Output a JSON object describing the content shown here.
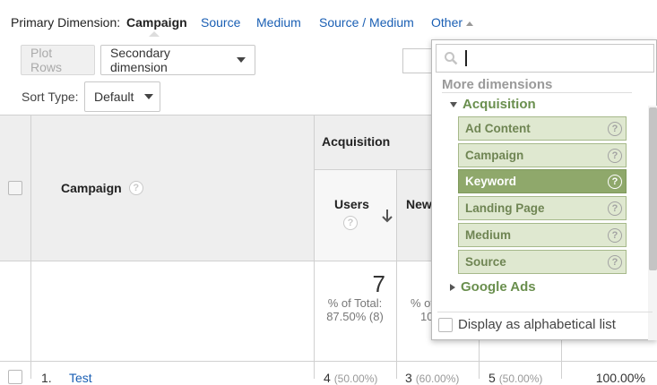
{
  "primary_dimension": {
    "label": "Primary Dimension:",
    "active": "Campaign",
    "options": [
      "Source",
      "Medium",
      "Source / Medium",
      "Other"
    ]
  },
  "toolbar": {
    "plot_rows": "Plot Rows",
    "secondary_dimension": "Secondary dimension",
    "sort_type_label": "Sort Type:",
    "sort_type_value": "Default"
  },
  "table": {
    "campaign_header": "Campaign",
    "acquisition_header": "Acquisition",
    "users_header": "Users",
    "new_users_header": "New",
    "totals": {
      "users_value": "7",
      "users_pct_label": "% of Total:",
      "users_pct_value": "87.50% (8)",
      "new_users_pct_partial": "% of",
      "new_users_value_partial": "10"
    },
    "rows": [
      {
        "index": "1.",
        "campaign": "Test",
        "users": "4",
        "users_pct": "(50.00%)",
        "new_users": "3",
        "new_users_pct": "(60.00%)",
        "sessions": "5",
        "sessions_pct": "(50.00%)",
        "rate": "100.00%"
      }
    ]
  },
  "dropdown": {
    "search_placeholder": "",
    "more_dimensions": "More dimensions",
    "acquisition_group": "Acquisition",
    "items": [
      "Ad Content",
      "Campaign",
      "Keyword",
      "Landing Page",
      "Medium",
      "Source"
    ],
    "selected_item": "Keyword",
    "google_ads_group": "Google Ads",
    "alphabetical_label": "Display as alphabetical list"
  },
  "colors": {
    "link": "#1a5fb4",
    "item_bg": "#dfe8d0",
    "item_selected_bg": "#8fa86b",
    "group_text": "#6a8f4e"
  },
  "icons": {
    "search": "search-icon",
    "help": "help-icon",
    "sort_desc": "arrow-down-icon"
  }
}
